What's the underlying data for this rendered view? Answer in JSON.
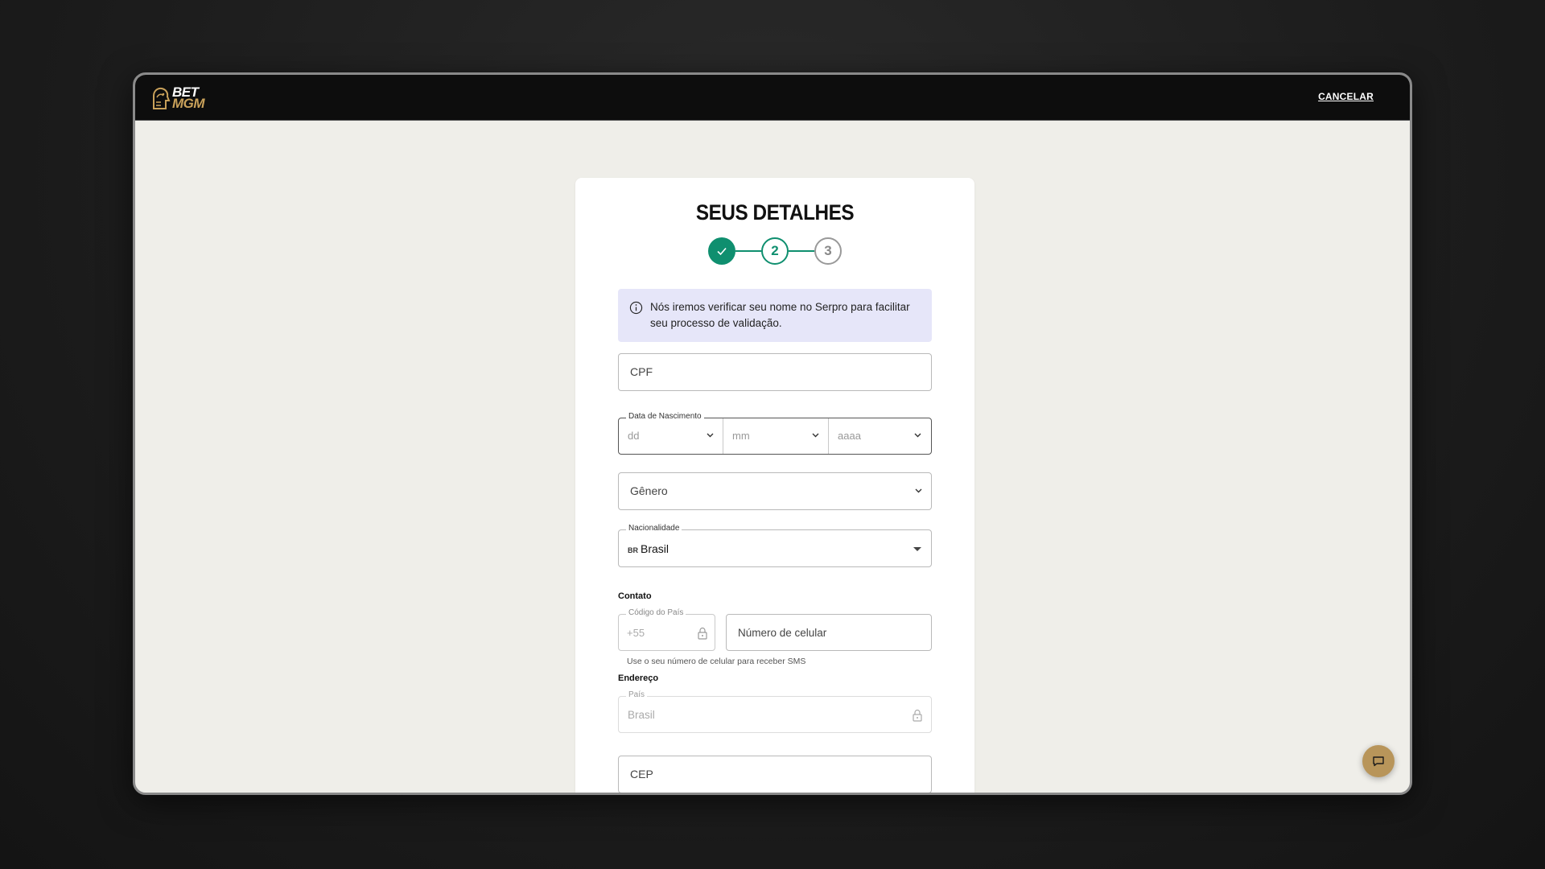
{
  "header": {
    "logo_top": "BET",
    "logo_bottom": "MGM",
    "cancel_label": "CANCELAR"
  },
  "form": {
    "title": "SEUS DETALHES",
    "steps": [
      {
        "label": "",
        "state": "done"
      },
      {
        "label": "2",
        "state": "active"
      },
      {
        "label": "3",
        "state": "todo"
      }
    ],
    "info_text": "Nós iremos verificar seu nome no Serpro para facilitar seu processo de validação.",
    "cpf_placeholder": "CPF",
    "dob": {
      "legend": "Data de Nascimento",
      "day_placeholder": "dd",
      "month_placeholder": "mm",
      "year_placeholder": "aaaa"
    },
    "gender_placeholder": "Gênero",
    "nationality": {
      "legend": "Nacionalidade",
      "flag": "BR",
      "value": "Brasil"
    },
    "contact": {
      "section_label": "Contato",
      "country_code_legend": "Código do País",
      "country_code_value": "+55",
      "phone_placeholder": "Número de celular",
      "hint": "Use o seu número de celular para receber SMS"
    },
    "address": {
      "section_label": "Endereço",
      "country_legend": "País",
      "country_value": "Brasil",
      "cep_placeholder": "CEP"
    }
  },
  "colors": {
    "accent": "#0f8f6f",
    "brand_gold": "#c9a15a",
    "info_bg": "#e6e6f9"
  },
  "icons": {
    "check": "check-icon",
    "info": "info-icon",
    "chevron": "chevron-down-icon",
    "lock": "lock-icon",
    "chat": "chat-icon"
  }
}
